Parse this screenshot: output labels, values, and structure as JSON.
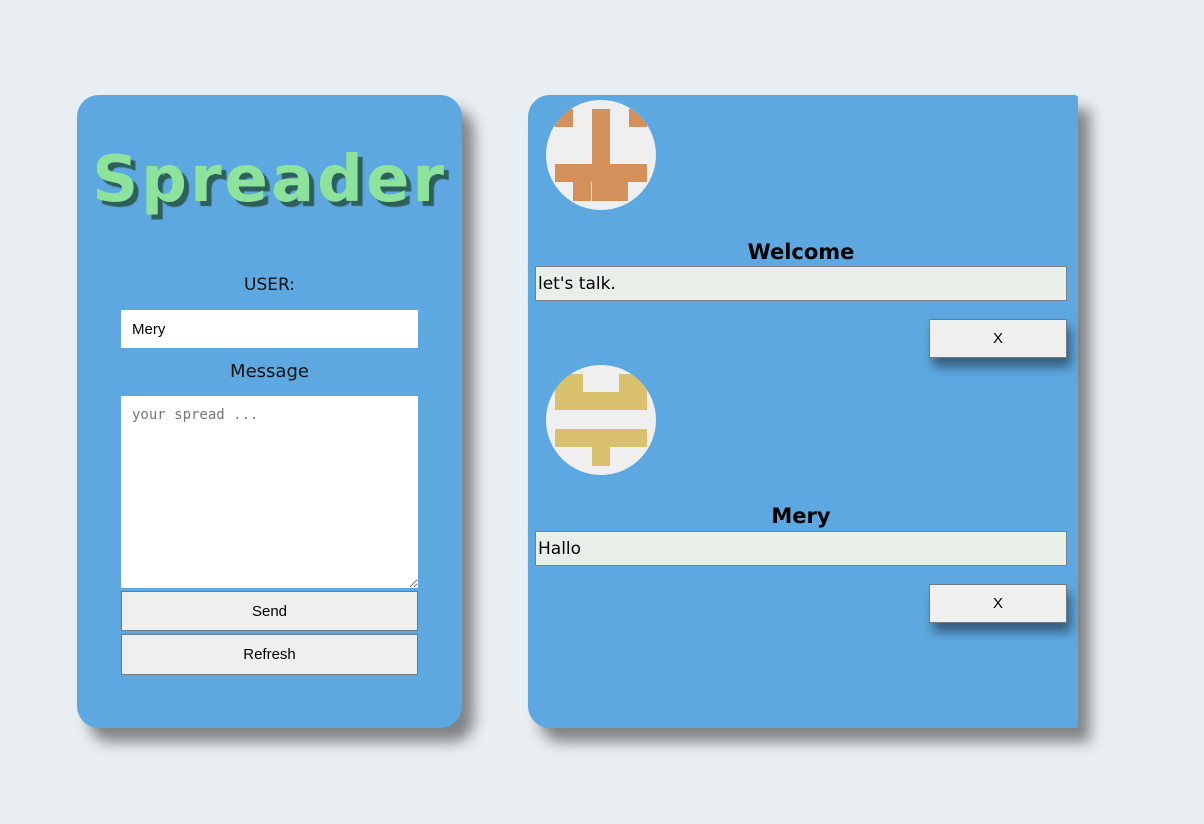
{
  "app": {
    "title": "Spreader"
  },
  "form": {
    "user_label": "USER:",
    "user_value": "Mery",
    "message_label": "Message",
    "message_placeholder": "your spread ...",
    "send_label": "Send",
    "refresh_label": "Refresh"
  },
  "posts": [
    {
      "name": "Welcome",
      "text": "let's talk.",
      "delete_label": "X",
      "avatar_color": "#d4905a",
      "avatar_icon": "identicon-avatar"
    },
    {
      "name": "Mery",
      "text": "Hallo",
      "delete_label": "X",
      "avatar_color": "#d8c06c",
      "avatar_icon": "identicon-avatar"
    }
  ],
  "colors": {
    "page_background": "#e9eef2",
    "panel_background": "#5ea8e1",
    "title_color": "#8ee39c",
    "post_text_background": "#e8eee8"
  }
}
